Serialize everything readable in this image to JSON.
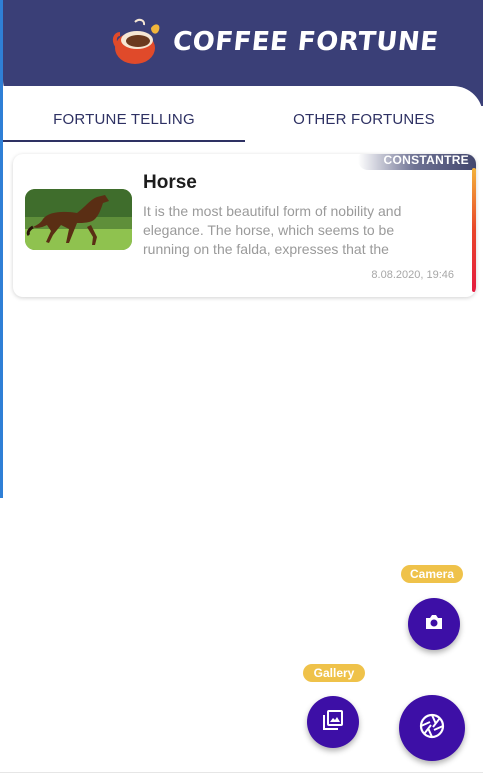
{
  "app": {
    "title": "COFFEE FORTUNE",
    "logo_icon": "coffee-cup-logo-icon"
  },
  "tabs": [
    {
      "label": "FORTUNE TELLING",
      "active": true
    },
    {
      "label": "OTHER FORTUNES",
      "active": false
    }
  ],
  "fortunes": [
    {
      "title": "Horse",
      "description": "It is the most beautiful form of nobility and elegance. The horse, which seems to be running on the falda, expresses that the",
      "date": "8.08.2020, 19:46",
      "badge": "CONSTANTRE",
      "image_icon": "horse-photo"
    }
  ],
  "fab": {
    "camera_label": "Camera",
    "gallery_label": "Gallery",
    "camera_icon": "camera-icon",
    "gallery_icon": "gallery-icon",
    "main_icon": "aperture-icon"
  },
  "colors": {
    "header": "#3a3f77",
    "tab_text": "#2e3163",
    "fab": "#3d0fa6",
    "fab_label": "#efc24a"
  }
}
